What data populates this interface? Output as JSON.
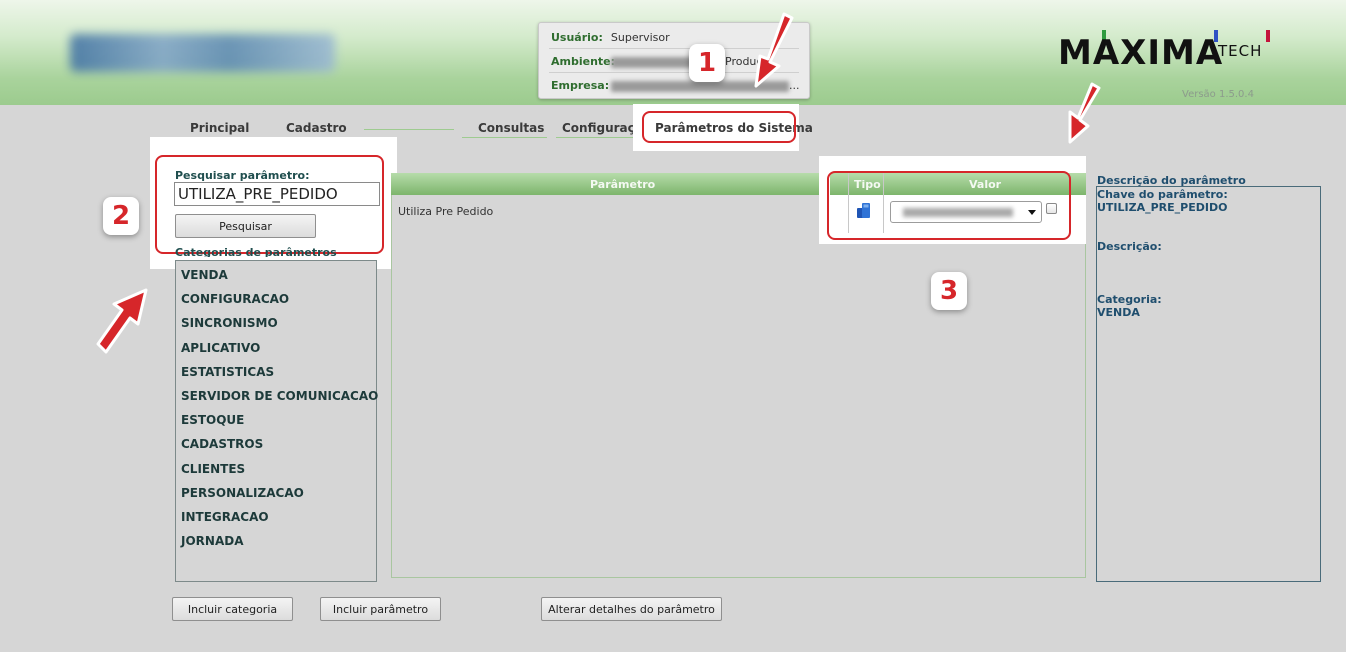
{
  "header": {
    "user_label": "Usuário:",
    "user_value": "Supervisor",
    "env_label": "Ambiente:",
    "env_value_visible": "Produç",
    "company_label": "Empresa:",
    "company_value_visible": "...",
    "brand_name": "MAXIMA",
    "brand_suffix": "TECH",
    "version": "Versão 1.5.0.4",
    "brand_colors": [
      "#2e9a3f",
      "#2f52c4",
      "#c4143c"
    ]
  },
  "tabs": [
    {
      "label": "Principal"
    },
    {
      "label": "Cadastro"
    },
    {
      "label": "Consultas"
    },
    {
      "label": "Configurações"
    },
    {
      "label": "Parâmetros do Sistema",
      "active": true
    }
  ],
  "search": {
    "label": "Pesquisar parâmetro:",
    "value": "UTILIZA_PRE_PEDIDO",
    "button": "Pesquisar"
  },
  "categories": {
    "label": "Categorias de parâmetros",
    "items": [
      "VENDA",
      "CONFIGURACAO",
      "SINCRONISMO",
      "APLICATIVO",
      "ESTATISTICAS",
      "SERVIDOR DE COMUNICACAO",
      "ESTOQUE",
      "CADASTROS",
      "CLIENTES",
      "PERSONALIZACAO",
      "INTEGRACAO",
      "JORNADA"
    ]
  },
  "grid": {
    "col_param": "Parâmetro",
    "col_type": "Tipo",
    "col_value": "Valor",
    "rows": [
      {
        "param": "Utiliza Pre Pedido",
        "type_icon": "database-icon",
        "checked": false
      }
    ]
  },
  "details": {
    "title": "Descrição do parâmetro",
    "key_label": "Chave do parâmetro:",
    "key_value": "UTILIZA_PRE_PEDIDO",
    "desc_label": "Descrição:",
    "category_label": "Categoria:",
    "category_value": "VENDA"
  },
  "actions": {
    "add_category": "Incluir categoria",
    "add_parameter": "Incluir parâmetro",
    "edit_details": "Alterar detalhes do parâmetro"
  },
  "annotations": {
    "step1": "1",
    "step2": "2",
    "step3": "3",
    "color": "#d6262a"
  }
}
